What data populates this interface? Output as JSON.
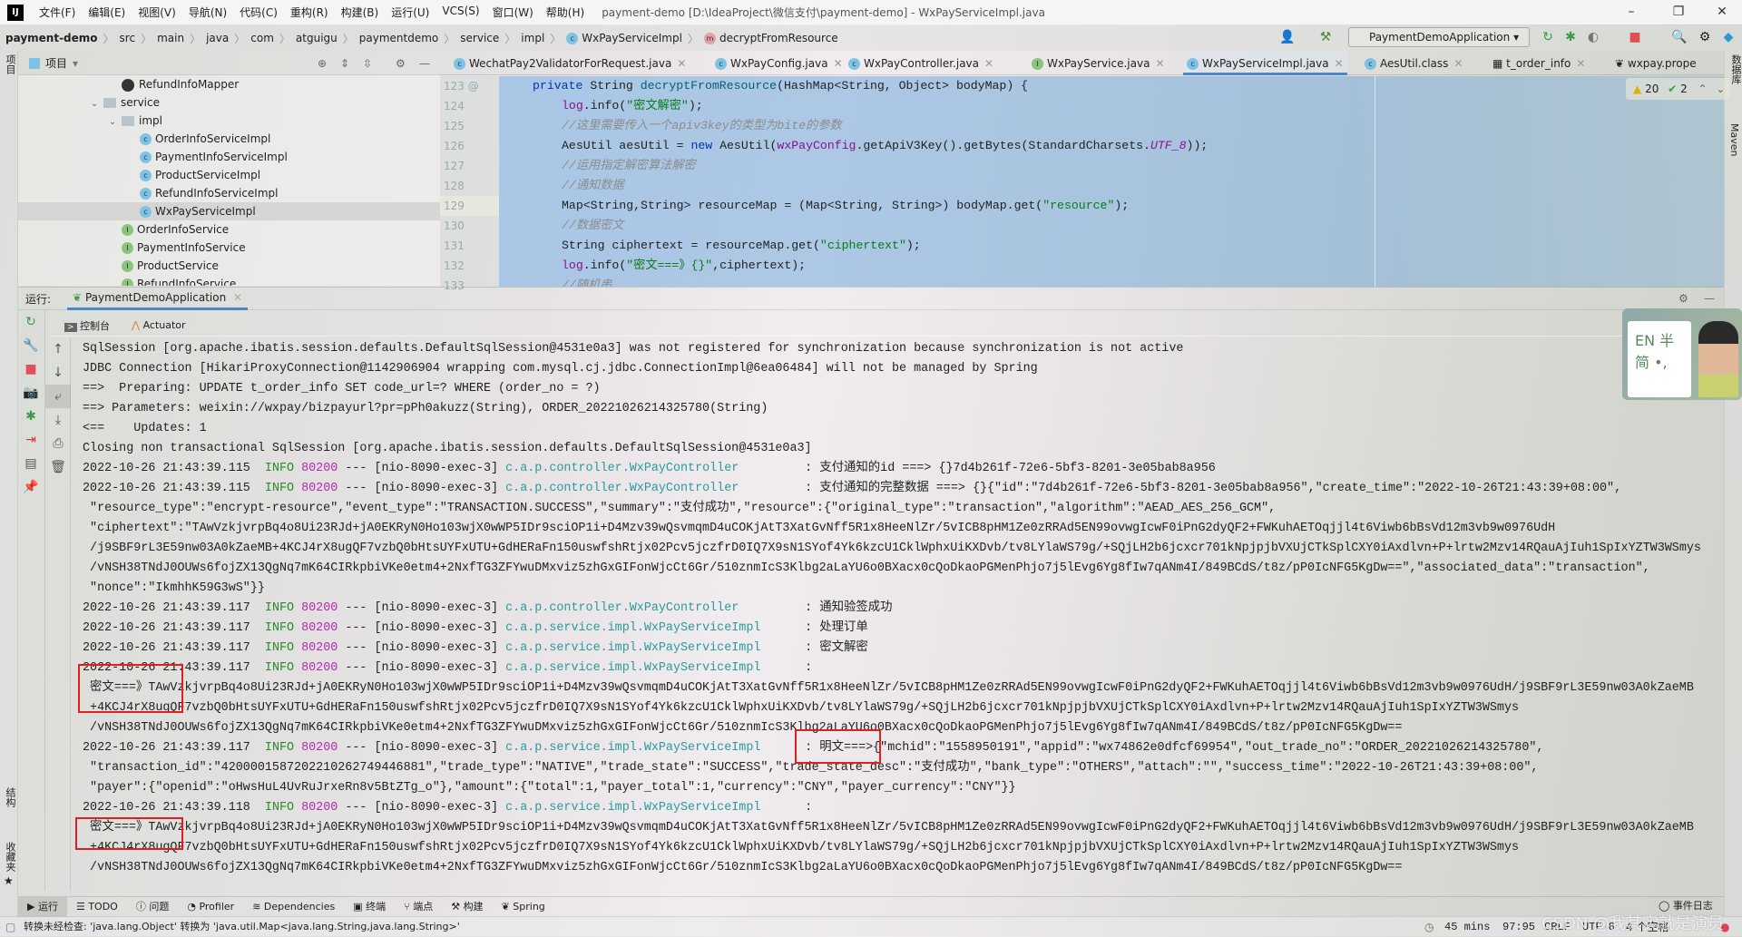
{
  "window": {
    "title": "payment-demo [D:\\IdeaProject\\微信支付\\payment-demo] - WxPayServiceImpl.java",
    "logo": "IJ",
    "menu": [
      "文件(F)",
      "编辑(E)",
      "视图(V)",
      "导航(N)",
      "代码(C)",
      "重构(R)",
      "构建(B)",
      "运行(U)",
      "VCS(S)",
      "窗口(W)",
      "帮助(H)"
    ],
    "controls": {
      "minimize": "–",
      "maximize": "❐",
      "close": "✕"
    }
  },
  "breadcrumb": [
    "payment-demo",
    "src",
    "main",
    "java",
    "com",
    "atguigu",
    "paymentdemo",
    "service",
    "impl",
    "WxPayServiceImpl",
    "decryptFromResource"
  ],
  "run_config": "PaymentDemoApplication",
  "project": {
    "label": "项目",
    "tree": [
      {
        "name": "RefundInfoMapper",
        "icon": "mapper",
        "depth": 3,
        "chevron": ""
      },
      {
        "name": "service",
        "icon": "folder",
        "depth": 2,
        "chevron": "⌄"
      },
      {
        "name": "impl",
        "icon": "folder",
        "depth": 3,
        "chevron": "⌄"
      },
      {
        "name": "OrderInfoServiceImpl",
        "icon": "class",
        "depth": 4,
        "chevron": ""
      },
      {
        "name": "PaymentInfoServiceImpl",
        "icon": "class",
        "depth": 4,
        "chevron": ""
      },
      {
        "name": "ProductServiceImpl",
        "icon": "class",
        "depth": 4,
        "chevron": ""
      },
      {
        "name": "RefundInfoServiceImpl",
        "icon": "class",
        "depth": 4,
        "chevron": ""
      },
      {
        "name": "WxPayServiceImpl",
        "icon": "class",
        "depth": 4,
        "chevron": "",
        "selected": true
      },
      {
        "name": "OrderInfoService",
        "icon": "interface",
        "depth": 3,
        "chevron": ""
      },
      {
        "name": "PaymentInfoService",
        "icon": "interface",
        "depth": 3,
        "chevron": ""
      },
      {
        "name": "ProductService",
        "icon": "interface",
        "depth": 3,
        "chevron": ""
      },
      {
        "name": "RefundInfoService",
        "icon": "interface",
        "depth": 3,
        "chevron": ""
      }
    ]
  },
  "editor_tabs": [
    {
      "label": "WechatPay2ValidatorForRequest.java",
      "icon": "class"
    },
    {
      "label": "WxPayConfig.java",
      "icon": "class"
    },
    {
      "label": "WxPayController.java",
      "icon": "class"
    },
    {
      "label": "WxPayService.java",
      "icon": "interface"
    },
    {
      "label": "WxPayServiceImpl.java",
      "icon": "class",
      "active": true
    },
    {
      "label": "AesUtil.class",
      "icon": "class"
    },
    {
      "label": "t_order_info",
      "icon": "table"
    },
    {
      "label": "wxpay.prope",
      "icon": "properties"
    }
  ],
  "inspections": {
    "warnings": "20",
    "typos": "2"
  },
  "code": {
    "current_line": 129,
    "lines": [
      {
        "n": 123,
        "indent": 0,
        "tokens": [
          [
            "private ",
            "kw"
          ],
          [
            "String ",
            ""
          ],
          [
            "decryptFromResource",
            "fn"
          ],
          [
            "(HashMap<String, Object> bodyMap) {",
            ""
          ]
        ]
      },
      {
        "n": 124,
        "indent": 1,
        "tokens": [
          [
            "log",
            "fld"
          ],
          [
            ".info(",
            ""
          ],
          [
            "\"密文解密\"",
            "str"
          ],
          [
            ");",
            ""
          ]
        ]
      },
      {
        "n": 125,
        "indent": 1,
        "tokens": [
          [
            "//这里需要传入一个apiv3key的类型为bite的参数",
            "cmt"
          ]
        ]
      },
      {
        "n": 126,
        "indent": 1,
        "tokens": [
          [
            "AesUtil aesUtil = ",
            ""
          ],
          [
            "new ",
            "kw"
          ],
          [
            "AesUtil(",
            ""
          ],
          [
            "wxPayConfig",
            "fld"
          ],
          [
            ".getApiV3Key().getBytes(StandardCharsets.",
            ""
          ],
          [
            "UTF_8",
            "it"
          ],
          [
            "));",
            ""
          ]
        ]
      },
      {
        "n": 127,
        "indent": 1,
        "tokens": [
          [
            "//运用指定解密算法解密",
            "cmt"
          ]
        ]
      },
      {
        "n": 128,
        "indent": 1,
        "tokens": [
          [
            "//通知数据",
            "cmt"
          ]
        ]
      },
      {
        "n": 129,
        "indent": 1,
        "tokens": [
          [
            "Map<String,String> resourceMap = (Map<String, String>) bodyMap.get(",
            ""
          ],
          [
            "\"resource\"",
            "str"
          ],
          [
            ");",
            ""
          ]
        ]
      },
      {
        "n": 130,
        "indent": 1,
        "tokens": [
          [
            "//数据密文",
            "cmt"
          ]
        ]
      },
      {
        "n": 131,
        "indent": 1,
        "tokens": [
          [
            "String ciphertext = resourceMap.get(",
            ""
          ],
          [
            "\"ciphertext\"",
            "str"
          ],
          [
            ");",
            ""
          ]
        ]
      },
      {
        "n": 132,
        "indent": 1,
        "tokens": [
          [
            "log",
            "fld"
          ],
          [
            ".info(",
            ""
          ],
          [
            "\"密文===》{}\"",
            "str"
          ],
          [
            ",ciphertext);",
            ""
          ]
        ]
      },
      {
        "n": 133,
        "indent": 1,
        "tokens": [
          [
            "//随机串",
            "cmt"
          ]
        ]
      }
    ]
  },
  "run_panel": {
    "label": "运行:",
    "tab": "PaymentDemoApplication",
    "subtabs": [
      "控制台",
      "Actuator"
    ]
  },
  "console": [
    {
      "t": "SqlSession [org.apache.ibatis.session.defaults.DefaultSqlSession@4531e0a3] was not registered for synchronization because synchronization is not active"
    },
    {
      "t": "JDBC Connection [HikariProxyConnection@1142906904 wrapping com.mysql.cj.jdbc.ConnectionImpl@6ea06484] will not be managed by Spring"
    },
    {
      "t": "==>  Preparing: UPDATE t_order_info SET code_url=? WHERE (order_no = ?)"
    },
    {
      "t": "==> Parameters: weixin://wxpay/bizpayurl?pr=pPh0akuzz(String), ORDER_20221026214325780(String)"
    },
    {
      "t": "<==    Updates: 1"
    },
    {
      "t": "Closing non transactional SqlSession [org.apache.ibatis.session.defaults.DefaultSqlSession@4531e0a3]"
    },
    {
      "ts": "2022-10-26 21:43:39.115",
      "level": "INFO",
      "pid": "80200",
      "thread": "[nio-8090-exec-3]",
      "logger": "c.a.p.controller.WxPayController",
      "msg": "支付通知的id ===> {}7d4b261f-72e6-5bf3-8201-3e05bab8a956"
    },
    {
      "ts": "2022-10-26 21:43:39.115",
      "level": "INFO",
      "pid": "80200",
      "thread": "[nio-8090-exec-3]",
      "logger": "c.a.p.controller.WxPayController",
      "msg": "支付通知的完整数据 ===> {}{\"id\":\"7d4b261f-72e6-5bf3-8201-3e05bab8a956\",\"create_time\":\"2022-10-26T21:43:39+08:00\","
    },
    {
      "t": " \"resource_type\":\"encrypt-resource\",\"event_type\":\"TRANSACTION.SUCCESS\",\"summary\":\"支付成功\",\"resource\":{\"original_type\":\"transaction\",\"algorithm\":\"AEAD_AES_256_GCM\","
    },
    {
      "t": " \"ciphertext\":\"TAwVzkjvrpBq4o8Ui23RJd+jA0EKRyN0Ho103wjX0wWP5IDr9sciOP1i+D4Mzv39wQsvmqmD4uCOKjAtT3XatGvNff5R1x8HeeNlZr/5vICB8pHM1Ze0zRRAd5EN99ovwgIcwF0iPnG2dyQF2+FWKuhAETOqjjl4t6Viwb6bBsVd12m3vb9w0976UdH"
    },
    {
      "t": " /j9SBF9rL3E59nw03A0kZaeMB+4KCJ4rX8ugQF7vzbQ0bHtsUYFxUTU+GdHERaFn150uswfshRtjx02Pcv5jczfrD0IQ7X9sN1SYof4Yk6kzcU1CklWphxUiKXDvb/tv8LYlaWS79g/+SQjLH2b6jcxcr701kNpjpjbVXUjCTkSplCXY0iAxdlvn+P+lrtw2Mzv14RQauAjIuh1SpIxYZTW3WSmys"
    },
    {
      "t": " /vNSH38TNdJ0OUWs6fojZX13QgNq7mK64CIRkpbiVKe0etm4+2NxfTG3ZFYwuDMxviz5zhGxGIFonWjcCt6Gr/510znmIcS3Klbg2aLaYU6o0BXacx0cQoDkaoPGMenPhjo7j5lEvg6Yg8fIw7qANm4I/849BCdS/t8z/pP0IcNFG5KgDw==\",\"associated_data\":\"transaction\","
    },
    {
      "t": " \"nonce\":\"IkmhhK59G3wS\"}}"
    },
    {
      "ts": "2022-10-26 21:43:39.117",
      "level": "INFO",
      "pid": "80200",
      "thread": "[nio-8090-exec-3]",
      "logger": "c.a.p.controller.WxPayController",
      "msg": "通知验签成功"
    },
    {
      "ts": "2022-10-26 21:43:39.117",
      "level": "INFO",
      "pid": "80200",
      "thread": "[nio-8090-exec-3]",
      "logger": "c.a.p.service.impl.WxPayServiceImpl",
      "msg": "处理订单"
    },
    {
      "ts": "2022-10-26 21:43:39.117",
      "level": "INFO",
      "pid": "80200",
      "thread": "[nio-8090-exec-3]",
      "logger": "c.a.p.service.impl.WxPayServiceImpl",
      "msg": "密文解密"
    },
    {
      "ts": "2022-10-26 21:43:39.117",
      "level": "INFO",
      "pid": "80200",
      "thread": "[nio-8090-exec-3]",
      "logger": "c.a.p.service.impl.WxPayServiceImpl",
      "msg": ""
    },
    {
      "t": " 密文===》TAwVzkjvrpBq4o8Ui23RJd+jA0EKRyN0Ho103wjX0wWP5IDr9sciOP1i+D4Mzv39wQsvmqmD4uCOKjAtT3XatGvNff5R1x8HeeNlZr/5vICB8pHM1Ze0zRRAd5EN99ovwgIcwF0iPnG2dyQF2+FWKuhAETOqjjl4t6Viwb6bBsVd12m3vb9w0976UdH/j9SBF9rL3E59nw03A0kZaeMB"
    },
    {
      "t": " +4KCJ4rX8ugQF7vzbQ0bHtsUYFxUTU+GdHERaFn150uswfshRtjx02Pcv5jczfrD0IQ7X9sN1SYof4Yk6kzcU1CklWphxUiKXDvb/tv8LYlaWS79g/+SQjLH2b6jcxcr701kNpjpjbVXUjCTkSplCXY0iAxdlvn+P+lrtw2Mzv14RQauAjIuh1SpIxYZTW3WSmys"
    },
    {
      "t": " /vNSH38TNdJ0OUWs6fojZX13QgNq7mK64CIRkpbiVKe0etm4+2NxfTG3ZFYwuDMxviz5zhGxGIFonWjcCt6Gr/510znmIcS3Klbg2aLaYU6o0BXacx0cQoDkaoPGMenPhjo7j5lEvg6Yg8fIw7qANm4I/849BCdS/t8z/pP0IcNFG5KgDw=="
    },
    {
      "ts": "2022-10-26 21:43:39.117",
      "level": "INFO",
      "pid": "80200",
      "thread": "[nio-8090-exec-3]",
      "logger": "c.a.p.service.impl.WxPayServiceImpl",
      "msg": "明文===>{\"mchid\":\"1558950191\",\"appid\":\"wx74862e0dfcf69954\",\"out_trade_no\":\"ORDER_20221026214325780\","
    },
    {
      "t": " \"transaction_id\":\"4200001587202210262749446881\",\"trade_type\":\"NATIVE\",\"trade_state\":\"SUCCESS\",\"trade_state_desc\":\"支付成功\",\"bank_type\":\"OTHERS\",\"attach\":\"\",\"success_time\":\"2022-10-26T21:43:39+08:00\","
    },
    {
      "t": " \"payer\":{\"openid\":\"oHwsHuL4UvRuJrxeRn8v5BtZTg_o\"},\"amount\":{\"total\":1,\"payer_total\":1,\"currency\":\"CNY\",\"payer_currency\":\"CNY\"}}"
    },
    {
      "ts": "2022-10-26 21:43:39.118",
      "level": "INFO",
      "pid": "80200",
      "thread": "[nio-8090-exec-3]",
      "logger": "c.a.p.service.impl.WxPayServiceImpl",
      "msg": ""
    },
    {
      "t": " 密文===》TAwVzkjvrpBq4o8Ui23RJd+jA0EKRyN0Ho103wjX0wWP5IDr9sciOP1i+D4Mzv39wQsvmqmD4uCOKjAtT3XatGvNff5R1x8HeeNlZr/5vICB8pHM1Ze0zRRAd5EN99ovwgIcwF0iPnG2dyQF2+FWKuhAETOqjjl4t6Viwb6bBsVd12m3vb9w0976UdH/j9SBF9rL3E59nw03A0kZaeMB"
    },
    {
      "t": " +4KCJ4rX8ugQF7vzbQ0bHtsUYFxUTU+GdHERaFn150uswfshRtjx02Pcv5jczfrD0IQ7X9sN1SYof4Yk6kzcU1CklWphxUiKXDvb/tv8LYlaWS79g/+SQjLH2b6jcxcr701kNpjpjbVXUjCTkSplCXY0iAxdlvn+P+lrtw2Mzv14RQauAjIuh1SpIxYZTW3WSmys"
    },
    {
      "t": " /vNSH38TNdJ0OUWs6fojZX13QgNq7mK64CIRkpbiVKe0etm4+2NxfTG3ZFYwuDMxviz5zhGxGIFonWjcCt6Gr/510znmIcS3Klbg2aLaYU6o0BXacx0cQoDkaoPGMenPhjo7j5lEvg6Yg8fIw7qANm4I/849BCdS/t8z/pP0IcNFG5KgDw=="
    }
  ],
  "bottom_tools": [
    "运行",
    "TODO",
    "问题",
    "Profiler",
    "Dependencies",
    "终端",
    "端点",
    "构建",
    "Spring"
  ],
  "event_log": "事件日志",
  "status": {
    "message": "转换未经检查: 'java.lang.Object' 转换为 'java.util.Map<java.lang.String,java.lang.String>'",
    "time": "45 mins",
    "position": "97:95",
    "line_sep": "CRLF",
    "encoding": "UTF-8",
    "indent": "4 个空格"
  },
  "side_labels": {
    "left_top": "项目",
    "structure": "结构",
    "favorites": "收藏夹",
    "database": "数据库",
    "maven": "Maven"
  },
  "widget": {
    "card_text": "EN 半 简 •,"
  },
  "watermark": "CSDN @我其实就是演员",
  "colors": {
    "accent": "#4a88c7",
    "info": "#2a8a2a",
    "pid": "#b32ab3",
    "logger": "#2a9a9a",
    "annotation": "#e02020"
  }
}
